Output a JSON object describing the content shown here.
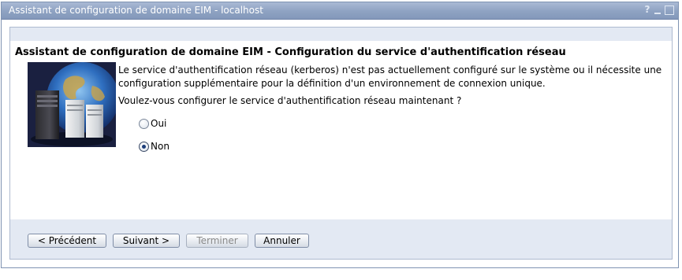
{
  "window": {
    "title": "Assistant de configuration de domaine EIM - localhost",
    "help_icon": "help-icon",
    "minimize_icon": "minimize-icon",
    "maximize_icon": "maximize-icon"
  },
  "heading": "Assistant de configuration de domaine EIM - Configuration du service d'authentification réseau",
  "description": "Le service d'authentification réseau (kerberos) n'est pas actuellement configuré sur le système ou il nécessite une configuration supplémentaire pour la définition d'un environnement de connexion unique.",
  "question": "Voulez-vous configurer le service d'authentification réseau maintenant ?",
  "options": [
    {
      "label": "Oui",
      "selected": false
    },
    {
      "label": "Non",
      "selected": true
    }
  ],
  "buttons": {
    "previous": "< Précédent",
    "next": "Suivant >",
    "finish": "Terminer",
    "cancel": "Annuler"
  },
  "colors": {
    "titlebar": "#8ea2c2",
    "panel_strip": "#e3e9f3",
    "border": "#7f93b2"
  }
}
